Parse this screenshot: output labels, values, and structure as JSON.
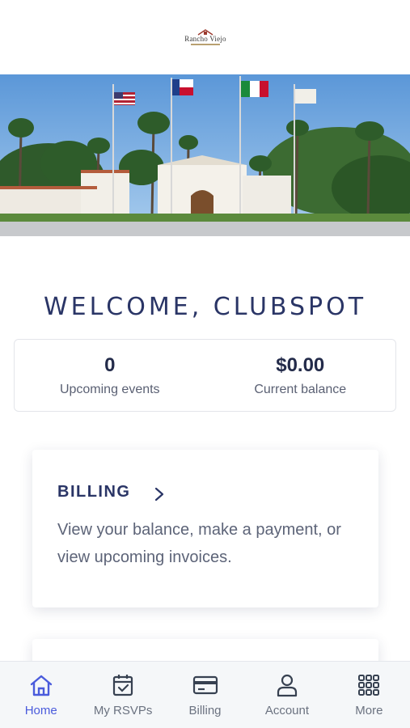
{
  "logo": {
    "wordmark": "Rancho Viejo"
  },
  "welcome": {
    "text": "WELCOME, CLUBSPOT"
  },
  "stats": [
    {
      "value": "0",
      "label": "Upcoming events"
    },
    {
      "value": "$0.00",
      "label": "Current balance"
    }
  ],
  "billing_card": {
    "title": "BILLING",
    "description": "View your balance, make a payment, or view upcoming invoices."
  },
  "tabs": [
    {
      "label": "Home",
      "icon": "home-icon",
      "active": true
    },
    {
      "label": "My RSVPs",
      "icon": "calendar-check-icon",
      "active": false
    },
    {
      "label": "Billing",
      "icon": "credit-card-icon",
      "active": false
    },
    {
      "label": "Account",
      "icon": "user-icon",
      "active": false
    },
    {
      "label": "More",
      "icon": "grid-dots-icon",
      "active": false
    }
  ],
  "colors": {
    "accent": "#4a5bdc",
    "heading": "#2a3566",
    "muted": "#5d6478"
  }
}
